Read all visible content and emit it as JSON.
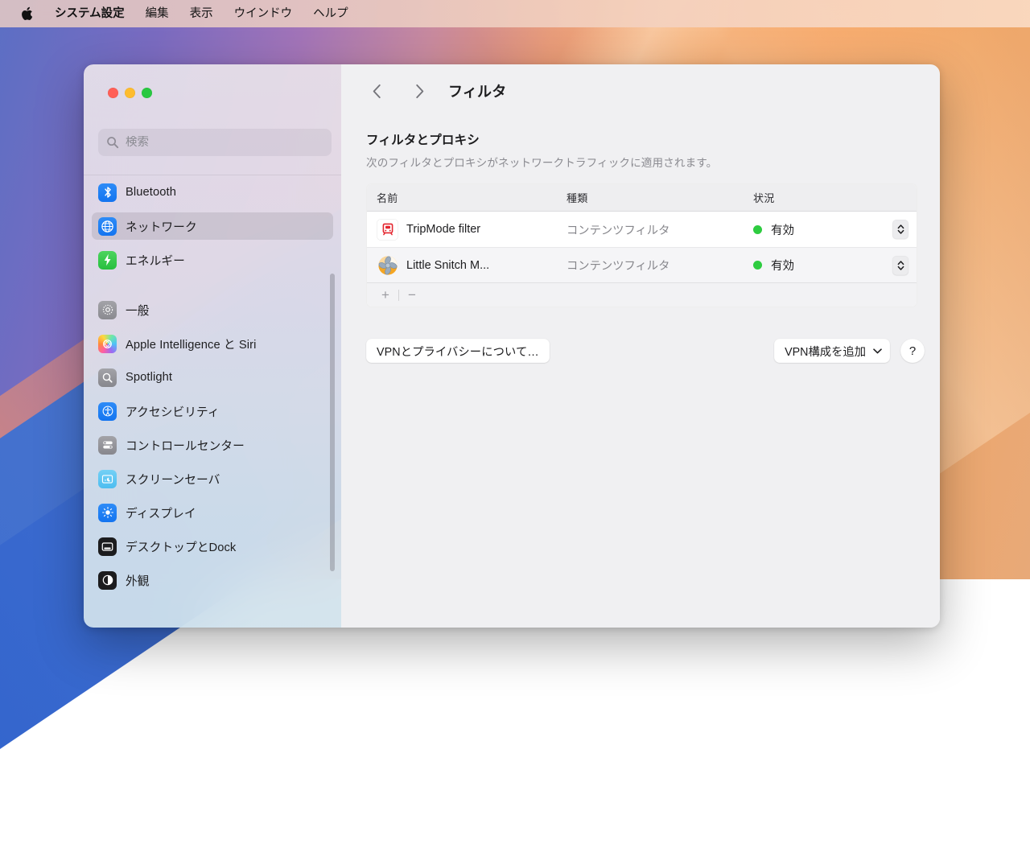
{
  "menubar": {
    "apple_icon": "apple-logo-icon",
    "items": [
      {
        "label": "システム設定",
        "bold": true
      },
      {
        "label": "編集",
        "bold": false
      },
      {
        "label": "表示",
        "bold": false
      },
      {
        "label": "ウインドウ",
        "bold": false
      },
      {
        "label": "ヘルプ",
        "bold": false
      }
    ]
  },
  "window": {
    "traffic_lights": {
      "close_color": "#ff5f57",
      "minimize_color": "#febc2e",
      "maximize_color": "#28c840"
    }
  },
  "sidebar": {
    "search": {
      "placeholder": "検索",
      "value": "",
      "icon": "search-icon"
    },
    "items": [
      {
        "label": "Bluetooth",
        "icon": "bluetooth-icon",
        "selected": false
      },
      {
        "label": "ネットワーク",
        "icon": "globe-icon",
        "selected": true
      },
      {
        "label": "エネルギー",
        "icon": "bolt-icon",
        "selected": false
      },
      {
        "label": "一般",
        "icon": "gear-icon",
        "selected": false
      },
      {
        "label": "Apple Intelligence と Siri",
        "icon": "siri-icon",
        "selected": false
      },
      {
        "label": "Spotlight",
        "icon": "magnifier-icon",
        "selected": false
      },
      {
        "label": "アクセシビリティ",
        "icon": "accessibility-icon",
        "selected": false
      },
      {
        "label": "コントロールセンター",
        "icon": "control-center-icon",
        "selected": false
      },
      {
        "label": "スクリーンセーバ",
        "icon": "screensaver-icon",
        "selected": false
      },
      {
        "label": "ディスプレイ",
        "icon": "brightness-icon",
        "selected": false
      },
      {
        "label": "デスクトップとDock",
        "icon": "desktop-dock-icon",
        "selected": false
      },
      {
        "label": "外観",
        "icon": "appearance-icon",
        "selected": false
      }
    ]
  },
  "content": {
    "back_icon": "chevron-left-icon",
    "forward_icon": "chevron-right-icon",
    "title": "フィルタ",
    "section": {
      "title": "フィルタとプロキシ",
      "subtitle": "次のフィルタとプロキシがネットワークトラフィックに適用されます。"
    },
    "table": {
      "columns": [
        "名前",
        "種類",
        "状況"
      ],
      "rows": [
        {
          "name": "TripMode filter",
          "kind": "コンテンツフィルタ",
          "status": "有効",
          "status_color": "#2ecc40",
          "icon": "tripmode-app-icon",
          "stepper_icon": "updown-chevron-icon"
        },
        {
          "name": "Little Snitch M...",
          "kind": "コンテンツフィルタ",
          "status": "有効",
          "status_color": "#2ecc40",
          "icon": "little-snitch-app-icon",
          "stepper_icon": "updown-chevron-icon"
        }
      ],
      "footer": {
        "add_label": "+",
        "remove_label": "−"
      }
    },
    "buttons": {
      "vpn_privacy": "VPNとプライバシーについて…",
      "add_vpn": "VPN構成を追加",
      "add_vpn_chevron": "chevron-down-icon",
      "help": "?"
    }
  }
}
